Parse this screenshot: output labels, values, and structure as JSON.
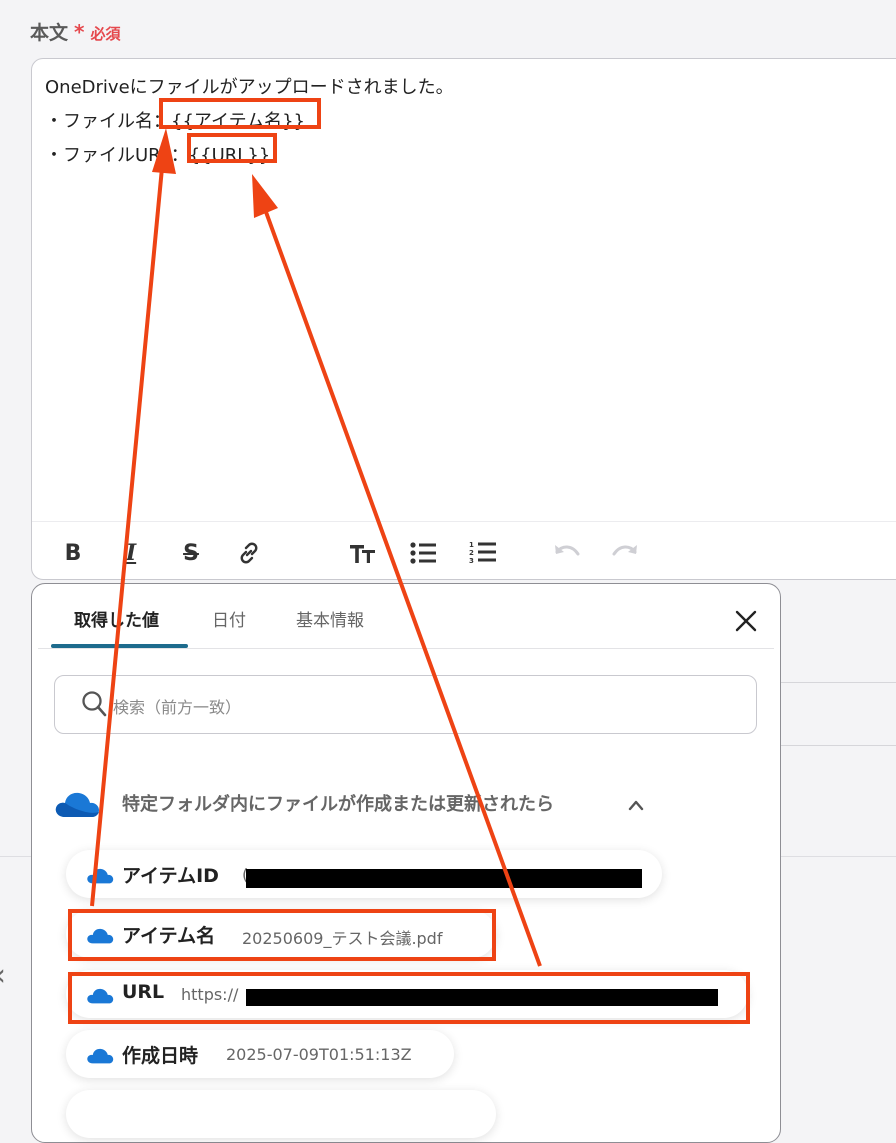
{
  "field": {
    "label": "本文",
    "asterisk": "*",
    "required": "必須"
  },
  "editor": {
    "lines": [
      "OneDriveにファイルがアップロードされました。",
      "・ファイル名：{{アイテム名}}",
      "・ファイルURL：{{URL}}"
    ],
    "toolbar_icons": [
      "bold-icon",
      "italic-icon",
      "strikethrough-icon",
      "link-icon",
      "text-size-icon",
      "bullet-list-icon",
      "numbered-list-icon",
      "undo-icon",
      "redo-icon"
    ]
  },
  "panel": {
    "tabs": [
      {
        "label": "取得した値",
        "active": true
      },
      {
        "label": "日付",
        "active": false
      },
      {
        "label": "基本情報",
        "active": false
      }
    ],
    "close_icon": "close-icon",
    "search": {
      "placeholder": "検索（前方一致）",
      "icon": "search-icon"
    },
    "group": {
      "title": "特定フォルダ内にファイルが作成または更新されたら",
      "icon": "onedrive-cloud-icon",
      "toggle_icon": "chevron-up-icon"
    },
    "items": [
      {
        "name": "アイテムID",
        "value": "(",
        "redacted": true
      },
      {
        "name": "アイテム名",
        "value": "20250609_テスト会議.pdf",
        "redacted": false
      },
      {
        "name": "URL",
        "value": "https://",
        "redacted": true
      },
      {
        "name": "作成日時",
        "value": "2025-07-09T01:51:13Z",
        "redacted": false
      }
    ]
  },
  "colors": {
    "highlight": "#ee4314",
    "tab_underline": "#1d6b8d",
    "required": "#e5484d",
    "onedrive": "#1a78d6"
  }
}
